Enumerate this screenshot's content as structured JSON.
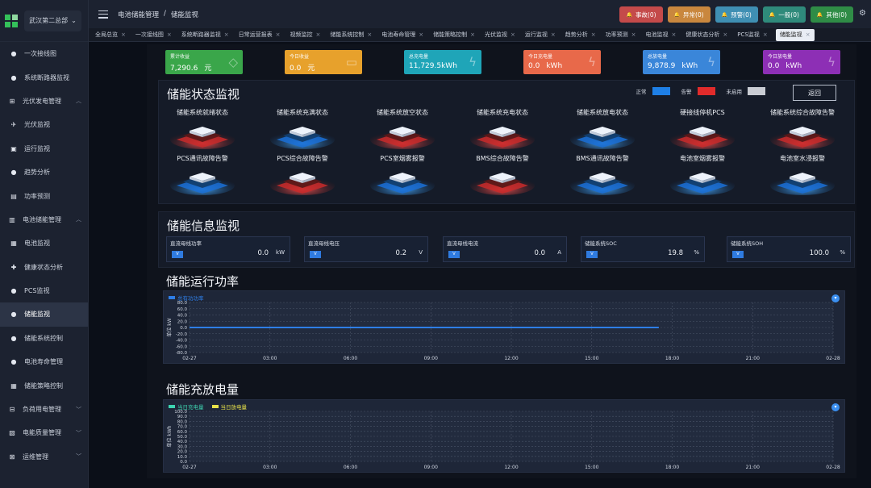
{
  "sidebar": {
    "station": "武汉第二总部",
    "items": [
      {
        "label": "一次接线图",
        "icon": "pin-icon",
        "kind": "sub"
      },
      {
        "label": "系统断路器监视",
        "icon": "pin-icon",
        "kind": "sub"
      },
      {
        "label": "光伏发电管理",
        "icon": "solar-icon",
        "kind": "grp",
        "chevron": "up"
      },
      {
        "label": "光伏监视",
        "icon": "monitor-icon",
        "kind": "sub"
      },
      {
        "label": "运行监视",
        "icon": "screen-icon",
        "kind": "sub"
      },
      {
        "label": "趋势分析",
        "icon": "pin-icon",
        "kind": "sub"
      },
      {
        "label": "功率预测",
        "icon": "chart-icon",
        "kind": "sub"
      },
      {
        "label": "电池储能管理",
        "icon": "battery-icon",
        "kind": "grp",
        "chevron": "up"
      },
      {
        "label": "电池监视",
        "icon": "grid-icon",
        "kind": "sub"
      },
      {
        "label": "健康状态分析",
        "icon": "health-icon",
        "kind": "sub"
      },
      {
        "label": "PCS监视",
        "icon": "pin-icon",
        "kind": "sub"
      },
      {
        "label": "储能监视",
        "icon": "pin-icon",
        "kind": "sub",
        "active": true
      },
      {
        "label": "储能系统控制",
        "icon": "pin-icon",
        "kind": "sub"
      },
      {
        "label": "电池寿命管理",
        "icon": "pin-icon",
        "kind": "sub"
      },
      {
        "label": "储能策略控制",
        "icon": "grid-icon",
        "kind": "sub"
      },
      {
        "label": "负荷用电管理",
        "icon": "load-icon",
        "kind": "grp",
        "chevron": "down"
      },
      {
        "label": "电能质量管理",
        "icon": "quality-icon",
        "kind": "grp",
        "chevron": "down"
      },
      {
        "label": "运维管理",
        "icon": "wrench-icon",
        "kind": "grp",
        "chevron": "down"
      }
    ]
  },
  "header": {
    "breadcrumb": [
      "电池储能管理",
      "/",
      "储能监视"
    ],
    "alarms": [
      {
        "label": "事故(0)",
        "color": "#c44a4a"
      },
      {
        "label": "异常(0)",
        "color": "#c9873e"
      },
      {
        "label": "预警(0)",
        "color": "#3f8fb3"
      },
      {
        "label": "一般(0)",
        "color": "#2f8a7b"
      },
      {
        "label": "其他(0)",
        "color": "#2f8c46"
      }
    ]
  },
  "tabs": [
    {
      "label": "全局总览"
    },
    {
      "label": "一次接线图"
    },
    {
      "label": "系统断路器监视"
    },
    {
      "label": "日常运营报表"
    },
    {
      "label": "视频监控"
    },
    {
      "label": "储能系统控制"
    },
    {
      "label": "电池寿命管理"
    },
    {
      "label": "储能策略控制"
    },
    {
      "label": "光伏监视"
    },
    {
      "label": "运行监视"
    },
    {
      "label": "趋势分析"
    },
    {
      "label": "功率预测"
    },
    {
      "label": "电池监视"
    },
    {
      "label": "健康状态分析"
    },
    {
      "label": "PCS监视"
    },
    {
      "label": "储能监视",
      "active": true
    }
  ],
  "kpis": [
    {
      "label": "累计收益",
      "value": "7,290.6",
      "unit": "元",
      "color": "#3aa64a",
      "icon": "diamond-icon"
    },
    {
      "label": "今日收益",
      "value": "0.0",
      "unit": "元",
      "color": "#e7a12c",
      "icon": "wallet-icon"
    },
    {
      "label": "总充电量",
      "value": "11,729.5kWh",
      "unit": "",
      "color": "#1fa5b8",
      "icon": "bolt-icon"
    },
    {
      "label": "今日充电量",
      "value": "0.0",
      "unit": "kWh",
      "color": "#e8694a",
      "icon": "bolt-icon"
    },
    {
      "label": "总放电量",
      "value": "9,878.9",
      "unit": "kWh",
      "color": "#3a86d9",
      "icon": "bolt-icon"
    },
    {
      "label": "今日放电量",
      "value": "0.0",
      "unit": "kWh",
      "color": "#8d2fb5",
      "icon": "bolt-icon"
    }
  ],
  "status": {
    "title": "储能状态监视",
    "legend": [
      {
        "label": "正常",
        "color": "#1e7fe6"
      },
      {
        "label": "告警",
        "color": "#e12b2b"
      },
      {
        "label": "未启用",
        "color": "#c9ccd3"
      }
    ],
    "back_label": "返回",
    "items": [
      {
        "label": "储能系统就绪状态",
        "state": "alarm"
      },
      {
        "label": "储能系统充满状态",
        "state": "normal"
      },
      {
        "label": "储能系统放空状态",
        "state": "alarm"
      },
      {
        "label": "储能系统充电状态",
        "state": "alarm"
      },
      {
        "label": "储能系统放电状态",
        "state": "normal"
      },
      {
        "label": "硬接线停机PCS",
        "state": "alarm"
      },
      {
        "label": "储能系统综合故障告警",
        "state": "alarm"
      },
      {
        "label": "PCS通讯故障告警",
        "state": "normal"
      },
      {
        "label": "PCS综合故障告警",
        "state": "alarm"
      },
      {
        "label": "PCS室烟雾报警",
        "state": "normal"
      },
      {
        "label": "BMS综合故障告警",
        "state": "alarm"
      },
      {
        "label": "BMS通讯故障告警",
        "state": "normal"
      },
      {
        "label": "电池室烟雾报警",
        "state": "normal"
      },
      {
        "label": "电池室水浸报警",
        "state": "normal"
      }
    ]
  },
  "info": {
    "title": "储能信息监视",
    "items": [
      {
        "label": "直流母线功率",
        "value": "0.0",
        "unit": "kW"
      },
      {
        "label": "直流母线电压",
        "value": "0.2",
        "unit": "V"
      },
      {
        "label": "直流母线电流",
        "value": "0.0",
        "unit": "A"
      },
      {
        "label": "储能系统SOC",
        "value": "19.8",
        "unit": "%"
      },
      {
        "label": "储能系统SOH",
        "value": "100.0",
        "unit": "%"
      }
    ]
  },
  "chart_data": [
    {
      "type": "line",
      "title": "储能运行功率",
      "ylabel": "单位 kW",
      "x": [
        "02-27",
        "03:00",
        "06:00",
        "09:00",
        "12:00",
        "15:00",
        "18:00",
        "21:00",
        "02-28"
      ],
      "yticks": [
        "80.0",
        "60.0",
        "40.0",
        "20.0",
        "0.0",
        "-20.0",
        "-40.0",
        "-60.0",
        "-80.0"
      ],
      "ylim": [
        -80,
        80
      ],
      "grid": true,
      "legend": "top-left",
      "series": [
        {
          "name": "总有功功率",
          "color": "#2e7ee6",
          "x_hours": [
            0,
            17.5
          ],
          "values": [
            0,
            0
          ]
        }
      ]
    },
    {
      "type": "line",
      "title": "储能充放电量",
      "ylabel": "单位 kWh",
      "x": [
        "02-27",
        "03:00",
        "06:00",
        "09:00",
        "12:00",
        "15:00",
        "18:00",
        "21:00",
        "02-28"
      ],
      "yticks": [
        "100.0",
        "90.0",
        "80.0",
        "70.0",
        "60.0",
        "50.0",
        "40.0",
        "30.0",
        "20.0",
        "10.0",
        "0.0"
      ],
      "ylim": [
        0,
        100
      ],
      "grid": true,
      "legend": "top-left",
      "series": [
        {
          "name": "当日充电量",
          "color": "#3dd3b0",
          "values": []
        },
        {
          "name": "当日放电量",
          "color": "#e8e24a",
          "values": []
        }
      ]
    }
  ]
}
